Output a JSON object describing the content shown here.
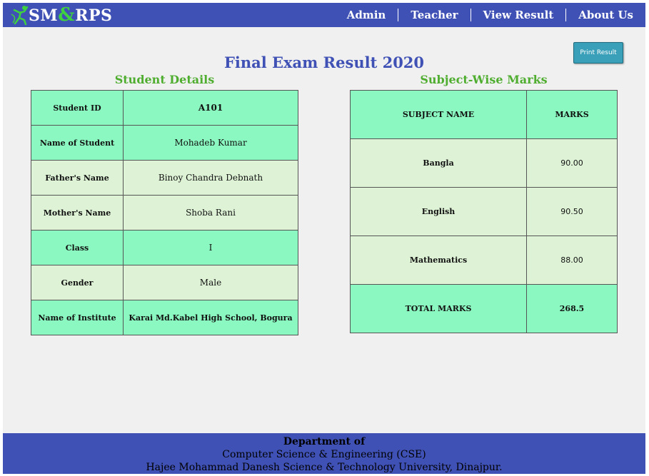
{
  "header": {
    "logo_text_left": "SM",
    "logo_amp": "&",
    "logo_text_right": "RPS",
    "logo_icon": "runner-figure-icon",
    "nav": [
      "Admin",
      "Teacher",
      "View Result",
      "About Us"
    ]
  },
  "toolbar": {
    "print_label": "Print Result"
  },
  "page_title": "Final Exam Result 2020",
  "student_section": {
    "title": "Student Details",
    "rows": [
      {
        "label": "Student ID",
        "value": "A101"
      },
      {
        "label": "Name of Student",
        "value": "Mohadeb Kumar"
      },
      {
        "label": "Father's Name",
        "value": "Binoy Chandra Debnath"
      },
      {
        "label": "Mother's Name",
        "value": "Shoba Rani"
      },
      {
        "label": "Class",
        "value": "I"
      },
      {
        "label": "Gender",
        "value": "Male"
      },
      {
        "label": "Name of Institute",
        "value": "Karai Md.Kabel High School, Bogura"
      }
    ]
  },
  "marks_section": {
    "title": "Subject-Wise Marks",
    "header": {
      "subject": "SUBJECT NAME",
      "marks": "MARKS"
    },
    "rows": [
      {
        "subject": "Bangla",
        "marks": "90.00"
      },
      {
        "subject": "English",
        "marks": "90.50"
      },
      {
        "subject": "Mathematics",
        "marks": "88.00"
      }
    ],
    "total": {
      "label": "TOTAL MARKS",
      "value": "268.5"
    }
  },
  "footer": {
    "line1": "Department of",
    "line2": "Computer Science & Engineering (CSE)",
    "line3": "Hajee Mohammad Danesh Science & Technology University, Dinajpur."
  },
  "colors": {
    "header_bg": "#3f51b5",
    "title": "#3f51b5",
    "section_title": "#4fad30",
    "row_green": "#8af8c0",
    "row_pale": "#def3d6",
    "button": "#3a9fb8"
  }
}
